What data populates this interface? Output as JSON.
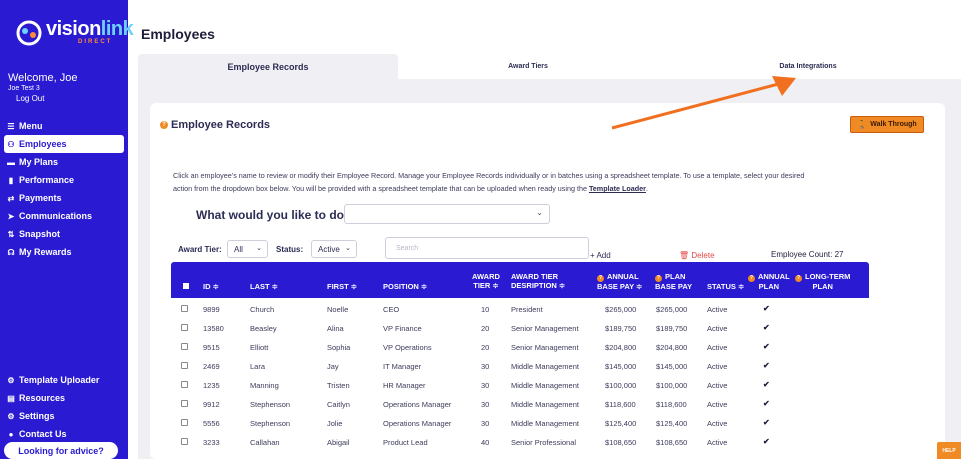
{
  "brand": {
    "name_main": "vision",
    "name_accent": "link",
    "sub": "DIRECT"
  },
  "user": {
    "welcome": "Welcome, Joe",
    "username": "Joe Test 3",
    "logout": "Log Out"
  },
  "sidebar": {
    "items": [
      {
        "icon": "menu-icon",
        "glyph": "☰",
        "label": "Menu"
      },
      {
        "icon": "employees-icon",
        "glyph": "⚇",
        "label": "Employees"
      },
      {
        "icon": "plans-icon",
        "glyph": "▬",
        "label": "My Plans"
      },
      {
        "icon": "performance-icon",
        "glyph": "▮",
        "label": "Performance"
      },
      {
        "icon": "payments-icon",
        "glyph": "⇄",
        "label": "Payments"
      },
      {
        "icon": "communications-icon",
        "glyph": "➤",
        "label": "Communications"
      },
      {
        "icon": "snapshot-icon",
        "glyph": "⇅",
        "label": "Snapshot"
      },
      {
        "icon": "rewards-icon",
        "glyph": "☊",
        "label": "My Rewards"
      }
    ],
    "bottom_items": [
      {
        "icon": "template-uploader-icon",
        "glyph": "⚙",
        "label": "Template Uploader"
      },
      {
        "icon": "resources-icon",
        "glyph": "▤",
        "label": "Resources"
      },
      {
        "icon": "settings-icon",
        "glyph": "⚙",
        "label": "Settings"
      },
      {
        "icon": "contact-icon",
        "glyph": "●",
        "label": "Contact Us"
      }
    ],
    "advice_button": "Looking for advice?"
  },
  "page_title": "Employees",
  "tabs": [
    "Employee Records",
    "Award Tiers",
    "Data Integrations"
  ],
  "card": {
    "title": "Employee Records",
    "walk_through": "Walk Through",
    "description_1": "Click an employee’s name to review or modify their Employee Record. Manage your Employee Records individually or in batches using a spreadsheet template. To use a template, select your desired",
    "description_2": "action from the dropdown box below. You will be provided with a spreadsheet template that can be uploaded when ready using the ",
    "description_link": "Template Loader",
    "description_end": ".",
    "question": "What would you like to do?",
    "action_value": ""
  },
  "filters": {
    "award_tier_label": "Award Tier:",
    "award_tier_value": "All",
    "status_label": "Status:",
    "status_value": "Active",
    "search_placeholder": "Search",
    "add_label": "Add",
    "delete_label": "Delete",
    "employee_count": "Employee Count: 27"
  },
  "table": {
    "headers": {
      "id": "ID ≑",
      "last": "LAST ≑",
      "first": "FIRST ≑",
      "position": "POSITION ≑",
      "award_tier_1": "AWARD",
      "award_tier_2": "TIER ≑",
      "award_desc_1": "AWARD TIER",
      "award_desc_2": "DESRIPTION ≑",
      "annual_base_1": "ANNUAL",
      "annual_base_2": "BASE PAY ≑",
      "plan_base_1": "PLAN",
      "plan_base_2": "BASE PAY",
      "status": "STATUS ≑",
      "annual_plan_1": "ANNUAL",
      "annual_plan_2": "PLAN",
      "longterm_1": "LONG-TERM",
      "longterm_2": "PLAN"
    },
    "rows": [
      {
        "id": "9899",
        "last": "Church",
        "first": "Noelle",
        "position": "CEO",
        "tier": "10",
        "desc": "President",
        "annual": "$265,000",
        "plan": "$265,000",
        "status": "Active",
        "annual_plan": "✔"
      },
      {
        "id": "13580",
        "last": "Beasley",
        "first": "Alina",
        "position": "VP Finance",
        "tier": "20",
        "desc": "Senior Management",
        "annual": "$189,750",
        "plan": "$189,750",
        "status": "Active",
        "annual_plan": "✔"
      },
      {
        "id": "9515",
        "last": "Elliott",
        "first": "Sophia",
        "position": "VP Operations",
        "tier": "20",
        "desc": "Senior Management",
        "annual": "$204,800",
        "plan": "$204,800",
        "status": "Active",
        "annual_plan": "✔"
      },
      {
        "id": "2469",
        "last": "Lara",
        "first": "Jay",
        "position": "IT Manager",
        "tier": "30",
        "desc": "Middle Management",
        "annual": "$145,000",
        "plan": "$145,000",
        "status": "Active",
        "annual_plan": "✔"
      },
      {
        "id": "1235",
        "last": "Manning",
        "first": "Tristen",
        "position": "HR Manager",
        "tier": "30",
        "desc": "Middle Management",
        "annual": "$100,000",
        "plan": "$100,000",
        "status": "Active",
        "annual_plan": "✔"
      },
      {
        "id": "9912",
        "last": "Stephenson",
        "first": "Caitlyn",
        "position": "Operations Manager",
        "tier": "30",
        "desc": "Middle Management",
        "annual": "$118,600",
        "plan": "$118,600",
        "status": "Active",
        "annual_plan": "✔"
      },
      {
        "id": "5556",
        "last": "Stephenson",
        "first": "Jolie",
        "position": "Operations Manager",
        "tier": "30",
        "desc": "Middle Management",
        "annual": "$125,400",
        "plan": "$125,400",
        "status": "Active",
        "annual_plan": "✔"
      },
      {
        "id": "3233",
        "last": "Callahan",
        "first": "Abigail",
        "position": "Product Lead",
        "tier": "40",
        "desc": "Senior Professional",
        "annual": "$108,650",
        "plan": "$108,650",
        "status": "Active",
        "annual_plan": "✔"
      }
    ]
  },
  "help_label": "HELP",
  "colors": {
    "brand_blue": "#2a1ad1",
    "accent_orange": "#f08a24",
    "delete_red": "#e24a4a"
  }
}
